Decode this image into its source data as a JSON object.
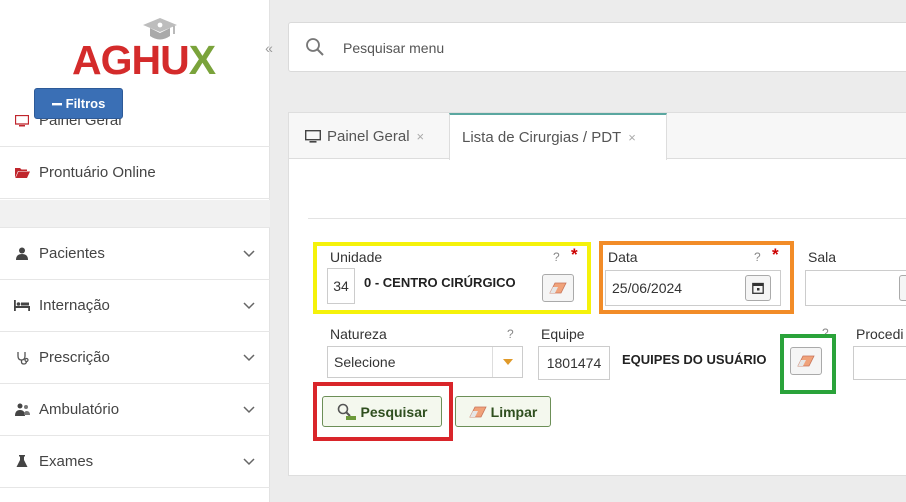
{
  "app": {
    "logo_main": "AGHU",
    "logo_x": "X"
  },
  "sidebar": {
    "collapse": "«",
    "items": [
      {
        "label": "Painel Geral",
        "icon": "monitor-icon"
      },
      {
        "label": "Prontuário Online",
        "icon": "folder-open-icon"
      },
      {
        "label": "Pacientes",
        "icon": "user-icon"
      },
      {
        "label": "Internação",
        "icon": "bed-icon"
      },
      {
        "label": "Prescrição",
        "icon": "stethoscope-icon"
      },
      {
        "label": "Ambulatório",
        "icon": "users-icon"
      },
      {
        "label": "Exames",
        "icon": "flask-icon"
      }
    ]
  },
  "search": {
    "placeholder": "Pesquisar menu"
  },
  "tabs": [
    {
      "label": "Painel Geral",
      "close": "×"
    },
    {
      "label": "Lista de Cirurgias / PDT",
      "close": "×"
    }
  ],
  "filters": {
    "toggle_label": "Filtros",
    "unidade": {
      "label": "Unidade",
      "code": "34",
      "value": "0 - CENTRO CIRÚRGICO",
      "help": "?",
      "required": "*"
    },
    "data": {
      "label": "Data",
      "value": "25/06/2024",
      "help": "?",
      "required": "*"
    },
    "sala": {
      "label": "Sala"
    },
    "natureza": {
      "label": "Natureza",
      "value": "Selecione",
      "help": "?"
    },
    "equipe": {
      "label": "Equipe",
      "code": "1801474",
      "value": "EQUIPES DO USUÁRIO",
      "help": "?"
    },
    "procedimento": {
      "label": "Procedi"
    },
    "search_button": "Pesquisar",
    "clear_button": "Limpar"
  },
  "colors": {
    "accent": "#3a6fb5",
    "logo_red": "#d42b2b",
    "logo_green": "#7aa33b",
    "highlight_yellow": "#f5f20a",
    "highlight_orange": "#f28c28",
    "highlight_green": "#2aa33a",
    "highlight_red": "#d9252a"
  }
}
